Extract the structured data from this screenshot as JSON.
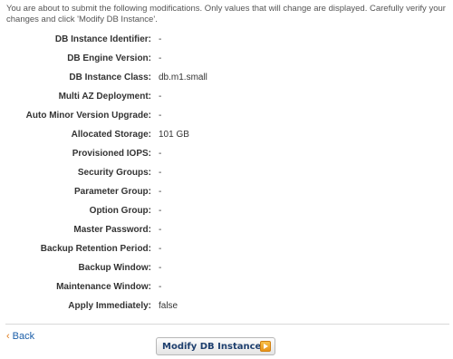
{
  "intro_text": "You are about to submit the following modifications. Only values that will change are displayed. Carefully verify your changes and click 'Modify DB Instance'.",
  "fields": [
    {
      "label": "DB Instance Identifier:",
      "value": "-"
    },
    {
      "label": "DB Engine Version:",
      "value": "-"
    },
    {
      "label": "DB Instance Class:",
      "value": "db.m1.small"
    },
    {
      "label": "Multi AZ Deployment:",
      "value": "-"
    },
    {
      "label": "Auto Minor Version Upgrade:",
      "value": "-"
    },
    {
      "label": "Allocated Storage:",
      "value": "101 GB"
    },
    {
      "label": "Provisioned IOPS:",
      "value": "-"
    },
    {
      "label": "Security Groups:",
      "value": "-"
    },
    {
      "label": "Parameter Group:",
      "value": "-"
    },
    {
      "label": "Option Group:",
      "value": "-"
    },
    {
      "label": "Master Password:",
      "value": "-"
    },
    {
      "label": "Backup Retention Period:",
      "value": "-"
    },
    {
      "label": "Backup Window:",
      "value": "-"
    },
    {
      "label": "Maintenance Window:",
      "value": "-"
    },
    {
      "label": "Apply Immediately:",
      "value": "false"
    }
  ],
  "back_link": {
    "chevron": "‹",
    "label": "Back"
  },
  "modify_button": {
    "label": "Modify DB Instance",
    "icon": "arrow-right-icon"
  },
  "colors": {
    "link": "#1a5ea8",
    "chevron": "#e07b1a",
    "button_icon": "#e8941a"
  }
}
